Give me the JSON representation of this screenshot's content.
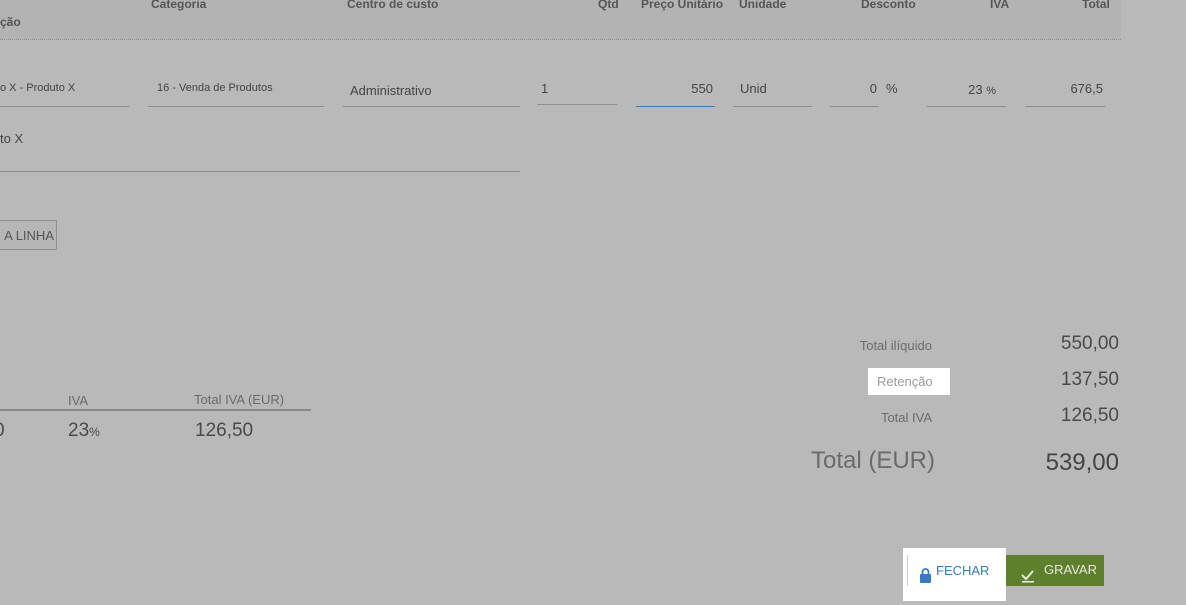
{
  "headers": {
    "descricao": "ção",
    "categoria": "Categoria",
    "centro_custo": "Centro de custo",
    "qtd": "Qtd",
    "preco_unitario": "Preço Unitário",
    "unidade": "Unidade",
    "desconto": "Desconto",
    "iva": "IVA",
    "total": "Total"
  },
  "line": {
    "artigo": "o X - Produto X",
    "categoria": "16 - Venda de Produtos",
    "centro_custo": "Administrativo",
    "qtd": "1",
    "preco_unitario": "550",
    "unidade": "Unid",
    "desconto": "0",
    "desconto_unit": "%",
    "iva": "23",
    "iva_unit": "%",
    "total": "676,5",
    "descricao": "to X"
  },
  "add_line_label": "A LINHA",
  "tax_table": {
    "headers": {
      "iva": "IVA",
      "total_iva": "Total IVA (EUR)"
    },
    "row": {
      "base": "0",
      "iva": "23",
      "iva_unit": "%",
      "total_iva": "126,50"
    }
  },
  "summary": {
    "total_iliquido_label": "Total ilíquido",
    "total_iliquido_value": "550,00",
    "retencao_label": "Retenção",
    "retencao_value": "137,50",
    "total_iva_label": "Total IVA",
    "total_iva_value": "126,50",
    "total_label": "Total (EUR)",
    "total_value": "539,00"
  },
  "buttons": {
    "close_label": "FECHAR",
    "close_icon": "lock-icon",
    "save_label": "GRAVAR",
    "save_icon": "check-icon"
  },
  "colors": {
    "overlay_bg": "#b9b9b9",
    "save_bg": "#5e7f2c",
    "close_text": "#3a78c3"
  }
}
